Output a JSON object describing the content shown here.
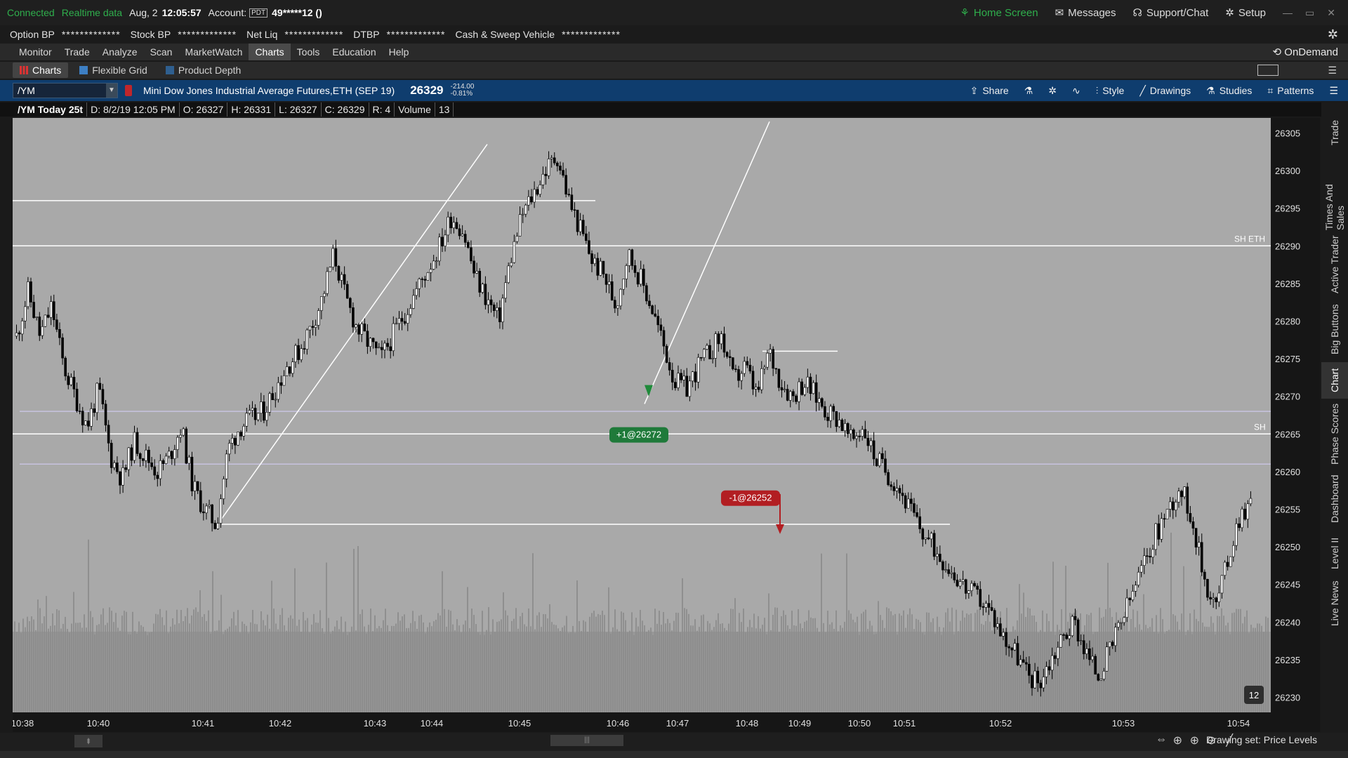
{
  "status": {
    "connected": "Connected",
    "realtime": "Realtime data",
    "date": "Aug, 2",
    "time": "12:05:57",
    "account_label": "Account:",
    "account_badge": "PDT",
    "account": "49*****12 ()",
    "home": "Home Screen",
    "messages": "Messages",
    "support": "Support/Chat",
    "setup": "Setup"
  },
  "bp": [
    {
      "k": "Option BP",
      "v": "*************"
    },
    {
      "k": "Stock BP",
      "v": "*************"
    },
    {
      "k": "Net Liq",
      "v": "*************"
    },
    {
      "k": "DTBP",
      "v": "*************"
    },
    {
      "k": "Cash & Sweep Vehicle",
      "v": "*************"
    }
  ],
  "menu": [
    "Monitor",
    "Trade",
    "Analyze",
    "Scan",
    "MarketWatch",
    "Charts",
    "Tools",
    "Education",
    "Help"
  ],
  "menu_active": "Charts",
  "ondemand": "OnDemand",
  "subtabs": [
    "Charts",
    "Flexible Grid",
    "Product Depth"
  ],
  "symbol": {
    "ticker": "/YM",
    "description": "Mini Dow Jones Industrial Average Futures,ETH (SEP 19)",
    "last": "26329",
    "change": "-214.00",
    "change_pct": "-0.81%"
  },
  "toolbar": {
    "share": "Share",
    "style": "Style",
    "drawings": "Drawings",
    "studies": "Studies",
    "patterns": "Patterns"
  },
  "info": {
    "title": "/YM Today 25t",
    "d": "D: 8/2/19 12:05 PM",
    "o": "O: 26327",
    "h": "H: 26331",
    "l": "L: 26327",
    "c": "C: 26329",
    "r": "R: 4",
    "vol_label": "Volume",
    "vol": "13"
  },
  "right_tabs": [
    "Trade",
    "Times And Sales",
    "Active Trader",
    "Big Buttons",
    "Chart",
    "Phase Scores",
    "Dashboard",
    "Level II",
    "Live News"
  ],
  "right_active": "Chart",
  "bottom": {
    "drawing_set": "Drawing set: Price Levels"
  },
  "colors": {
    "chart_bg": "#a9a9a9",
    "candle": "#000000",
    "volume": "#8f8f8f",
    "buy": "#1f7a3a",
    "sell": "#b21e22",
    "level": "#ffffff",
    "band": "#c7c3e0"
  },
  "chart_data": {
    "type": "candlestick",
    "ylim": [
      26228,
      26307
    ],
    "y_ticks": [
      26305,
      26300,
      26295,
      26290,
      26285,
      26280,
      26275,
      26270,
      26265,
      26260,
      26255,
      26250,
      26245,
      26240,
      26235,
      26230
    ],
    "x_ticks": [
      "10:38",
      "10:40",
      "10:41",
      "10:42",
      "10:43",
      "10:44",
      "10:45",
      "10:46",
      "10:47",
      "10:48",
      "10:49",
      "10:50",
      "10:51",
      "10:52",
      "10:53",
      "10:54"
    ],
    "price_path": [
      26278,
      26284,
      26278,
      26282,
      26274,
      26270,
      26266,
      26271,
      26262,
      26259,
      26264,
      26262,
      26260,
      26262,
      26266,
      26258,
      26255,
      26253,
      26263,
      26266,
      26267,
      26268,
      26271,
      26274,
      26276,
      26279,
      26283,
      26289,
      26283,
      26279,
      26277,
      26275,
      26278,
      26281,
      26284,
      26287,
      26290,
      26294,
      26292,
      26286,
      26283,
      26280,
      26288,
      26294,
      26297,
      26300,
      26302,
      26296,
      26292,
      26288,
      26286,
      26282,
      26289,
      26286,
      26282,
      26277,
      26272,
      26271,
      26274,
      26276,
      26278,
      26272,
      26274,
      26270,
      26276,
      26272,
      26270,
      26272,
      26270,
      26268,
      26267,
      26264,
      26266,
      26262,
      26260,
      26258,
      26255,
      26252,
      26250,
      26248,
      26246,
      26244,
      26243,
      26241,
      26238,
      26236,
      26233,
      26232,
      26235,
      26238,
      26240,
      26236,
      26233,
      26236,
      26240,
      26244,
      26248,
      26252,
      26255,
      26258,
      26254,
      26246,
      26242,
      26248,
      26254,
      26256
    ],
    "annotations": [
      {
        "text": "+1@26272",
        "side": "buy"
      },
      {
        "text": "-1@26252",
        "side": "sell"
      },
      {
        "text": "SH ETH",
        "price": 26290
      },
      {
        "text": "SH",
        "price": 26265
      }
    ],
    "levels": [
      26296,
      26290,
      26265,
      26268,
      26261,
      26253,
      26276
    ],
    "volume_badge": "12"
  }
}
